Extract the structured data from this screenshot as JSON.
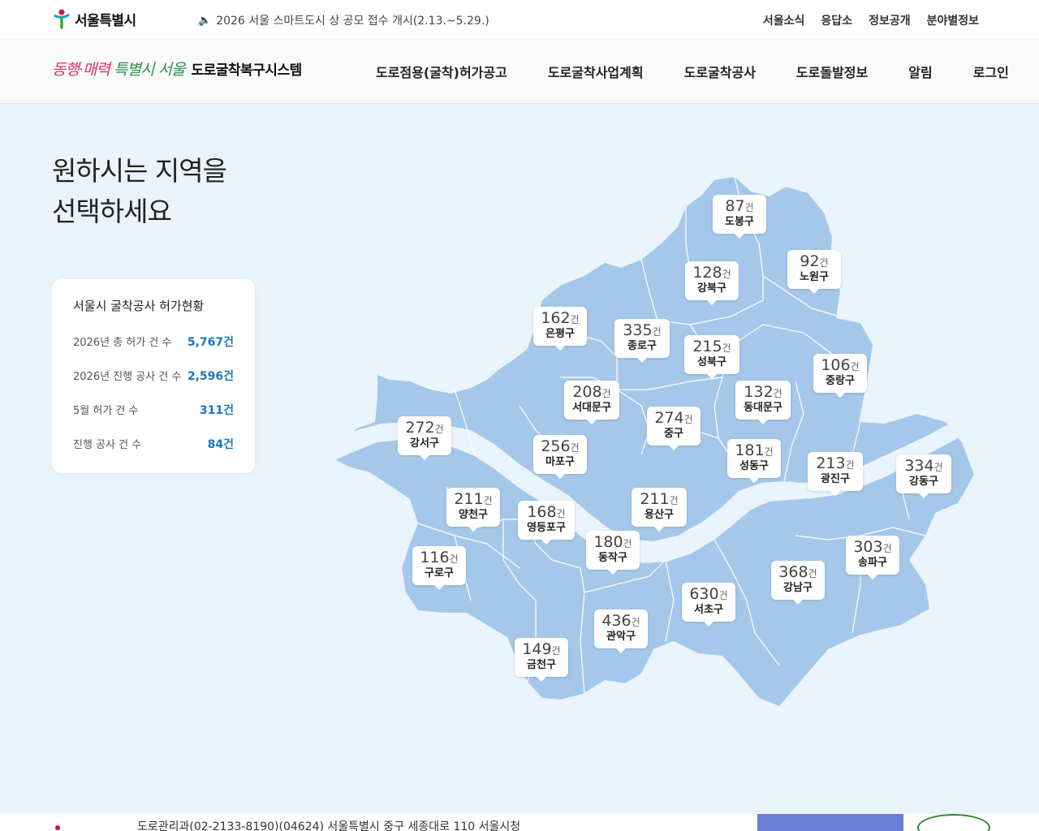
{
  "header": {
    "logo_text": "서울특별시",
    "notice": "2026 서울 스마트도시 상 공모 접수 개시(2.13.~5.29.)",
    "top_links": [
      "서울소식",
      "응답소",
      "정보공개",
      "분야별정보"
    ]
  },
  "nav": {
    "slogan_pink": "동행·매력",
    "slogan_green": "특별시 서울",
    "system_name": "도로굴착복구시스템",
    "menu": [
      "도로점용(굴착)허가공고",
      "도로굴착사업계획",
      "도로굴착공사",
      "도로돌발정보",
      "알림",
      "로그인"
    ]
  },
  "hero": {
    "title_line1": "원하시는 지역을",
    "title_line2": "선택하세요"
  },
  "stats": {
    "title": "서울시 굴착공사 허가현황",
    "rows": [
      {
        "label": "2026년 총 허가 건 수",
        "value": "5,767건"
      },
      {
        "label": "2026년 진행 공사 건 수",
        "value": "2,596건"
      },
      {
        "label": "5월 허가 건 수",
        "value": "311건"
      },
      {
        "label": "진행 공사 건 수",
        "value": "84건"
      }
    ]
  },
  "map": {
    "fill_color": "#a5c8ea",
    "unit": "건",
    "districts": [
      {
        "name": "도봉구",
        "count": "87"
      },
      {
        "name": "강북구",
        "count": "128"
      },
      {
        "name": "노원구",
        "count": "92"
      },
      {
        "name": "은평구",
        "count": "162"
      },
      {
        "name": "종로구",
        "count": "335"
      },
      {
        "name": "성북구",
        "count": "215"
      },
      {
        "name": "중랑구",
        "count": "106"
      },
      {
        "name": "서대문구",
        "count": "208"
      },
      {
        "name": "동대문구",
        "count": "132"
      },
      {
        "name": "중구",
        "count": "274"
      },
      {
        "name": "강서구",
        "count": "272"
      },
      {
        "name": "마포구",
        "count": "256"
      },
      {
        "name": "성동구",
        "count": "181"
      },
      {
        "name": "광진구",
        "count": "213"
      },
      {
        "name": "강동구",
        "count": "334"
      },
      {
        "name": "양천구",
        "count": "211"
      },
      {
        "name": "영등포구",
        "count": "168"
      },
      {
        "name": "용산구",
        "count": "211"
      },
      {
        "name": "동작구",
        "count": "180"
      },
      {
        "name": "송파구",
        "count": "303"
      },
      {
        "name": "구로구",
        "count": "116"
      },
      {
        "name": "강남구",
        "count": "368"
      },
      {
        "name": "서초구",
        "count": "630"
      },
      {
        "name": "관악구",
        "count": "436"
      },
      {
        "name": "금천구",
        "count": "149"
      }
    ]
  },
  "footer": {
    "address": "도로관리과(02-2133-8190)(04624) 서울특별시 중구 세종대로 110 서울시청"
  }
}
